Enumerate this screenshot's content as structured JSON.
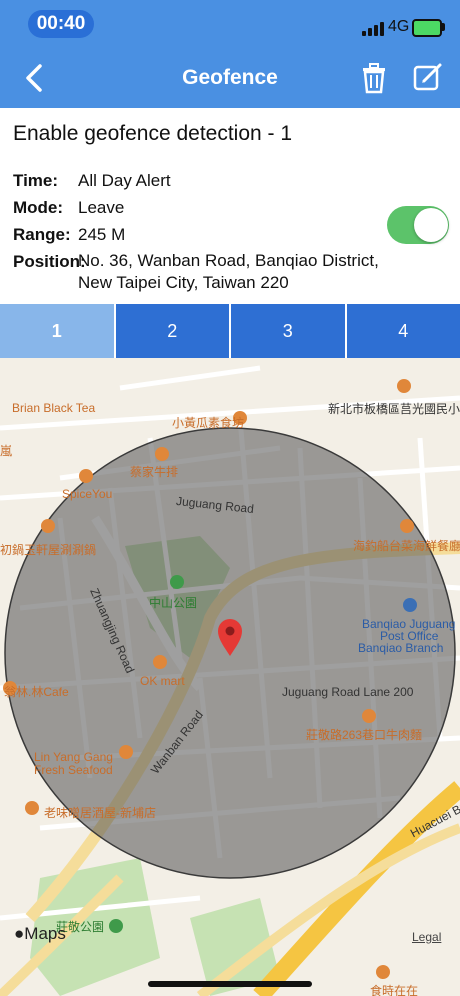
{
  "status_bar": {
    "time": "00:40",
    "network": "4G"
  },
  "navbar": {
    "title": "Geofence",
    "back_icon": "chevron-left-icon",
    "delete_icon": "trash-icon",
    "edit_icon": "edit-icon"
  },
  "detail": {
    "heading": "Enable geofence detection - 1",
    "time_label": "Time:",
    "time_value": "All Day Alert",
    "mode_label": "Mode:",
    "mode_value": "Leave",
    "range_label": "Range:",
    "range_value": "245 M",
    "position_label": "Position:",
    "position_value": "No. 36, Wanban Road, Banqiao District, New Taipei City, Taiwan 220",
    "enabled": true
  },
  "tabs": [
    {
      "label": "1",
      "active": true
    },
    {
      "label": "2",
      "active": false
    },
    {
      "label": "3",
      "active": false
    },
    {
      "label": "4",
      "active": false
    }
  ],
  "map": {
    "labels": {
      "brian": "Brian Black Tea",
      "lan": "嵐",
      "xiaohuanggua": "小黃瓜素食坊",
      "caijia": "蔡家牛排",
      "xinbei": "新北市板橋區莒光國民小",
      "juguang_road": "Juguang Road",
      "spiceyou": "SpiceYou",
      "chuyun": "初鍋玉軒屋涮涮鍋",
      "haidiao": "海釣船台菜海鮮餐廳",
      "zhuangjing": "Zhuangjing Road",
      "zhongshan": "中山公園",
      "post1": "Banqiao Juguang",
      "post2": "Post Office",
      "post3": "Banqiao Branch",
      "linje": "翁林.林Cafe",
      "okmart": "OK mart",
      "juguang_lane": "Juguang Road Lane 200",
      "zhuangjing_noodle": "莊敬路263巷口牛肉麵",
      "linyang1": "Lin Yang Gang",
      "linyang2": "Fresh Seafood",
      "wanban": "Wanban Road",
      "laowei": "老味噌居酒屋-新埔店",
      "huacuei": "Huacuei Br",
      "zhuangjing_park": "莊敬公園",
      "shiqi": "食時在在"
    },
    "logo": "Maps",
    "legal": "Legal",
    "circle_color": "#5a5a5a",
    "pin_color": "#e53935"
  }
}
